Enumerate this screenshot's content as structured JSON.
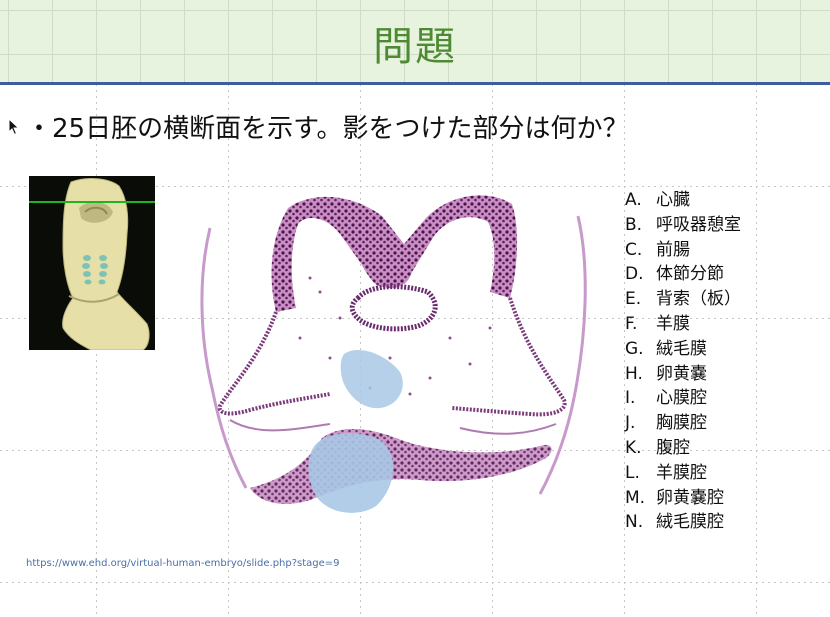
{
  "slide": {
    "title": "問題",
    "question": "・25日胚の横断面を示す。影をつけた部分は何か？",
    "options": [
      {
        "letter": "A.",
        "text": "心臓"
      },
      {
        "letter": "B.",
        "text": "呼吸器憩室"
      },
      {
        "letter": "C.",
        "text": "前腸"
      },
      {
        "letter": "D.",
        "text": "体節分節"
      },
      {
        "letter": "E.",
        "text": "背索（板）"
      },
      {
        "letter": "F.",
        "text": "羊膜"
      },
      {
        "letter": "G.",
        "text": "絨毛膜"
      },
      {
        "letter": "H.",
        "text": "卵黄嚢"
      },
      {
        "letter": "I.",
        "text": "心膜腔"
      },
      {
        "letter": "J.",
        "text": "胸膜腔"
      },
      {
        "letter": "K.",
        "text": "腹腔"
      },
      {
        "letter": "L.",
        "text": "羊膜腔"
      },
      {
        "letter": "M.",
        "text": "卵黄嚢腔"
      },
      {
        "letter": "N.",
        "text": "絨毛膜腔"
      }
    ],
    "source_url": "https://www.ehd.org/virtual-human-embryo/slide.php?stage=9"
  },
  "colors": {
    "title": "#4e8a33",
    "header_bg": "#e8f3df",
    "header_rule": "#3d5d9c",
    "tissue": "#6b2a6e",
    "highlight": "#a9c8e6",
    "link": "#4a6fa8"
  },
  "images": {
    "embryo_3d": "3d-embryo-model-with-green-section-line",
    "histology": "embryo-transverse-section-with-shaded-regions"
  }
}
